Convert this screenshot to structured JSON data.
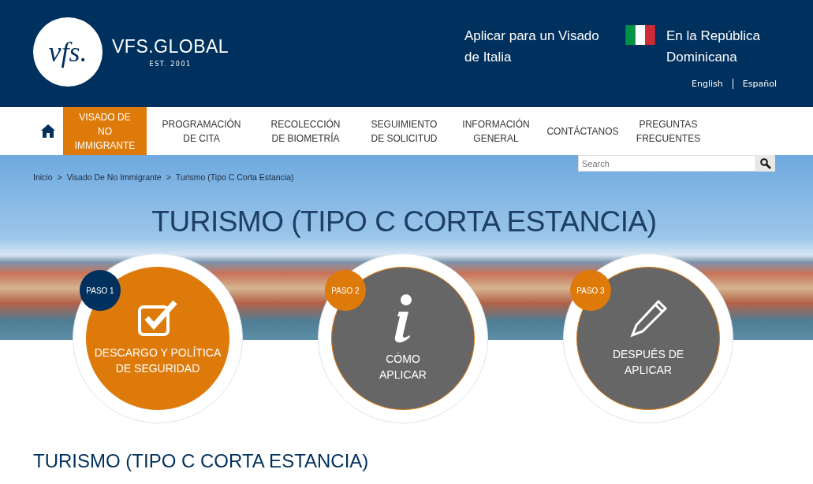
{
  "header": {
    "logo_mark": "vfs.",
    "logo_name": "VFS.GLOBAL",
    "logo_tagline": "EST. 2001",
    "apply_text": "Aplicar para un Visado de Italia",
    "location_text": "En la República Dominicana",
    "languages": [
      {
        "label": "English",
        "selected": false
      },
      {
        "label": "Español",
        "selected": false
      }
    ]
  },
  "nav": {
    "items": [
      {
        "label": "VISADO DE NO IMMIGRANTE",
        "selected": true
      },
      {
        "label": "PROGRAMACIÓN DE CITA",
        "selected": false
      },
      {
        "label": "RECOLECCIÓN DE BIOMETRÍA",
        "selected": false
      },
      {
        "label": "SEGUIMIENTO DE SOLICITUD",
        "selected": false
      },
      {
        "label": "INFORMACIÓN GENERAL",
        "selected": false
      },
      {
        "label": "CONTÁCTANOS",
        "selected": false
      },
      {
        "label": "PREGUNTAS FRECUENTES",
        "selected": false
      }
    ]
  },
  "search": {
    "placeholder": "Search"
  },
  "breadcrumbs": [
    "Inicio",
    "Visado De No Immigrante",
    "Turismo (Tipo C Corta Estancia)"
  ],
  "breadcrumb_separator": ">",
  "hero_title": "TURISMO (TIPO C CORTA ESTANCIA)",
  "steps": [
    {
      "badge": "PASO 1",
      "label": "DESCARGO Y POLÍTICA DE SEGURIDAD",
      "kind": "check",
      "selected": true
    },
    {
      "badge": "PASO 2",
      "label": "CÓMO APLICAR",
      "kind": "info",
      "selected": false
    },
    {
      "badge": "PASO 3",
      "label": "DESPUÉS DE APLICAR",
      "kind": "pencil",
      "selected": false
    }
  ],
  "section_title": "TURISMO (TIPO C CORTA ESTANCIA)"
}
